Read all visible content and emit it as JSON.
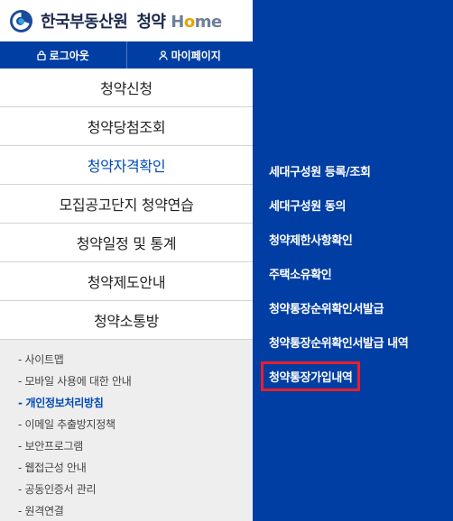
{
  "header": {
    "brand": "한국부동산원",
    "service": "청약",
    "home_h": "H",
    "home_o": "o",
    "home_me": "me"
  },
  "util": {
    "logout": "로그아웃",
    "mypage": "마이페이지"
  },
  "menu": [
    {
      "label": "청약신청"
    },
    {
      "label": "청약당첨조회"
    },
    {
      "label": "청약자격확인"
    },
    {
      "label": "모집공고단지 청약연습"
    },
    {
      "label": "청약일정 및 통계"
    },
    {
      "label": "청약제도안내"
    },
    {
      "label": "청약소통방"
    }
  ],
  "footer": [
    {
      "label": "- 사이트맵"
    },
    {
      "label": "- 모바일 사용에 대한 안내"
    },
    {
      "label": "- 개인정보처리방침"
    },
    {
      "label": "- 이메일 추출방지정책"
    },
    {
      "label": "- 보안프로그램"
    },
    {
      "label": "- 웹접근성 안내"
    },
    {
      "label": "- 공동인증서 관리"
    },
    {
      "label": "- 원격연결"
    }
  ],
  "submenu": [
    {
      "label": "세대구성원 등록/조회"
    },
    {
      "label": "세대구성원 동의"
    },
    {
      "label": "청약제한사항확인"
    },
    {
      "label": "주택소유확인"
    },
    {
      "label": "청약통장순위확인서발급"
    },
    {
      "label": "청약통장순위확인서발급 내역"
    },
    {
      "label": "청약통장가입내역"
    }
  ],
  "colors": {
    "brand_blue": "#003ea4",
    "active_text": "#0049b8",
    "highlight_box": "#e8202a"
  }
}
